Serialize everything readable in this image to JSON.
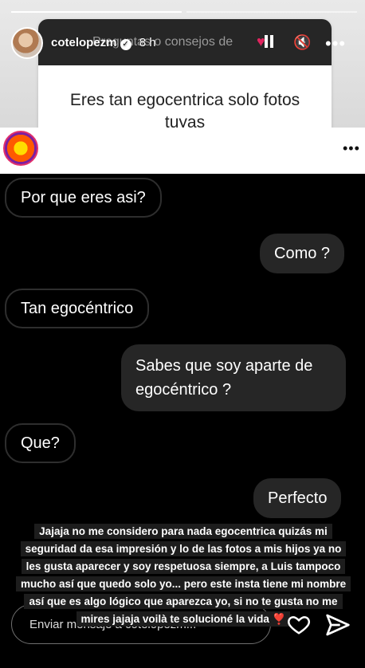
{
  "story": {
    "progress_segments": 2,
    "progress_filled": 1,
    "question_header": "Preguntas o consejos de",
    "question": "Eres tan egocentrica solo fotos tuyas",
    "user": {
      "username": "cotelopezm",
      "time": "8 h"
    }
  },
  "chat": {
    "messages": [
      {
        "side": "left",
        "text": "Por que eres asi?"
      },
      {
        "side": "right",
        "text": "Como ?"
      },
      {
        "side": "left",
        "text": "Tan egocéntrico"
      },
      {
        "side": "right",
        "text": "Sabes que soy aparte de egocéntrico ?"
      },
      {
        "side": "left",
        "text": "Que?"
      },
      {
        "side": "right",
        "text": "Perfecto"
      }
    ]
  },
  "caption": "Jajaja no me considero para nada egocentrica quizás mi seguridad da esa impresión y lo de las fotos a mis hijos ya no les gusta aparecer y soy respetuosa siempre, a Luis tampoco mucho así que quedo solo yo... pero este insta tiene mi nombre así que es algo lógico que aparezca yo, si no te gusta no me mires jajaja voilà te solucioné la vida ❣️",
  "reply": {
    "placeholder": "Enviar mensaje a cotelopezm..."
  },
  "icons": {
    "heart": "heart-icon",
    "send": "send-icon",
    "mute": "speaker-muted-icon",
    "more": "more-icon"
  },
  "colors": {
    "dark_bubble": "#262626",
    "story_header": "#262626"
  }
}
